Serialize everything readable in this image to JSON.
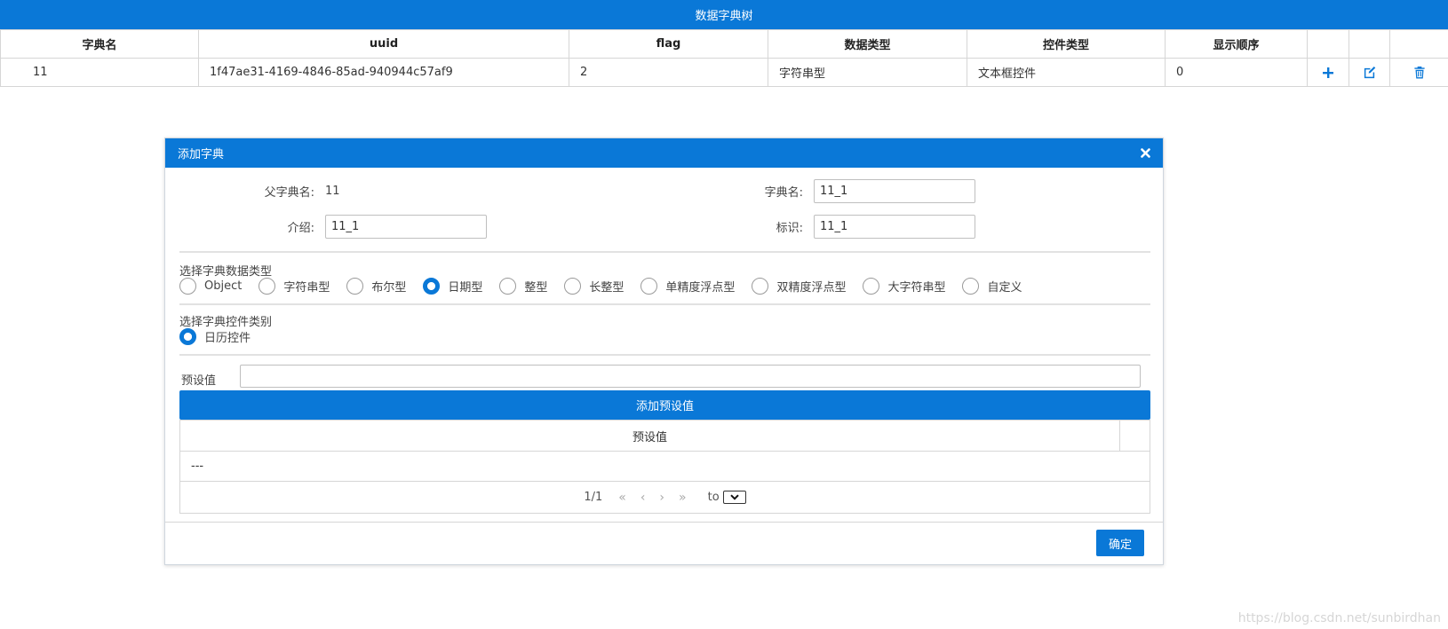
{
  "app": {
    "title": "数据字典树"
  },
  "table": {
    "columns": [
      "字典名",
      "uuid",
      "flag",
      "数据类型",
      "控件类型",
      "显示顺序"
    ],
    "rows": [
      {
        "name": "11",
        "uuid": "1f47ae31-4169-4846-85ad-940944c57af9",
        "flag": "2",
        "data_type": "字符串型",
        "control_type": "文本框控件",
        "order": "0"
      }
    ],
    "row_actions": [
      "plus-icon",
      "edit-icon",
      "trash-icon"
    ]
  },
  "modal": {
    "title": "添加字典",
    "parent_label": "父字典名:",
    "parent_value": "11",
    "name_label": "字典名:",
    "name_value": "11_1",
    "intro_label": "介绍:",
    "intro_value": "11_1",
    "flag_label": "标识:",
    "flag_value": "11_1",
    "data_type_title": "选择字典数据类型",
    "data_types": [
      "Object",
      "字符串型",
      "布尔型",
      "日期型",
      "整型",
      "长整型",
      "单精度浮点型",
      "双精度浮点型",
      "大字符串型",
      "自定义"
    ],
    "data_type_selected": "日期型",
    "control_type_title": "选择字典控件类别",
    "control_types": [
      "日历控件"
    ],
    "control_type_selected": "日历控件",
    "preset_label": "预设值",
    "preset_value": "",
    "add_preset_button": "添加预设值",
    "preset_table_header": "预设值",
    "preset_rows": [
      "---"
    ],
    "pager": {
      "info": "1/1",
      "first": "«",
      "prev": "‹",
      "next": "›",
      "last": "»",
      "to_label": "to"
    },
    "ok_button": "确定"
  },
  "watermark": "https://blog.csdn.net/sunbirdhan",
  "colors": {
    "accent": "#0a78d7",
    "border": "#d6d6d6"
  }
}
